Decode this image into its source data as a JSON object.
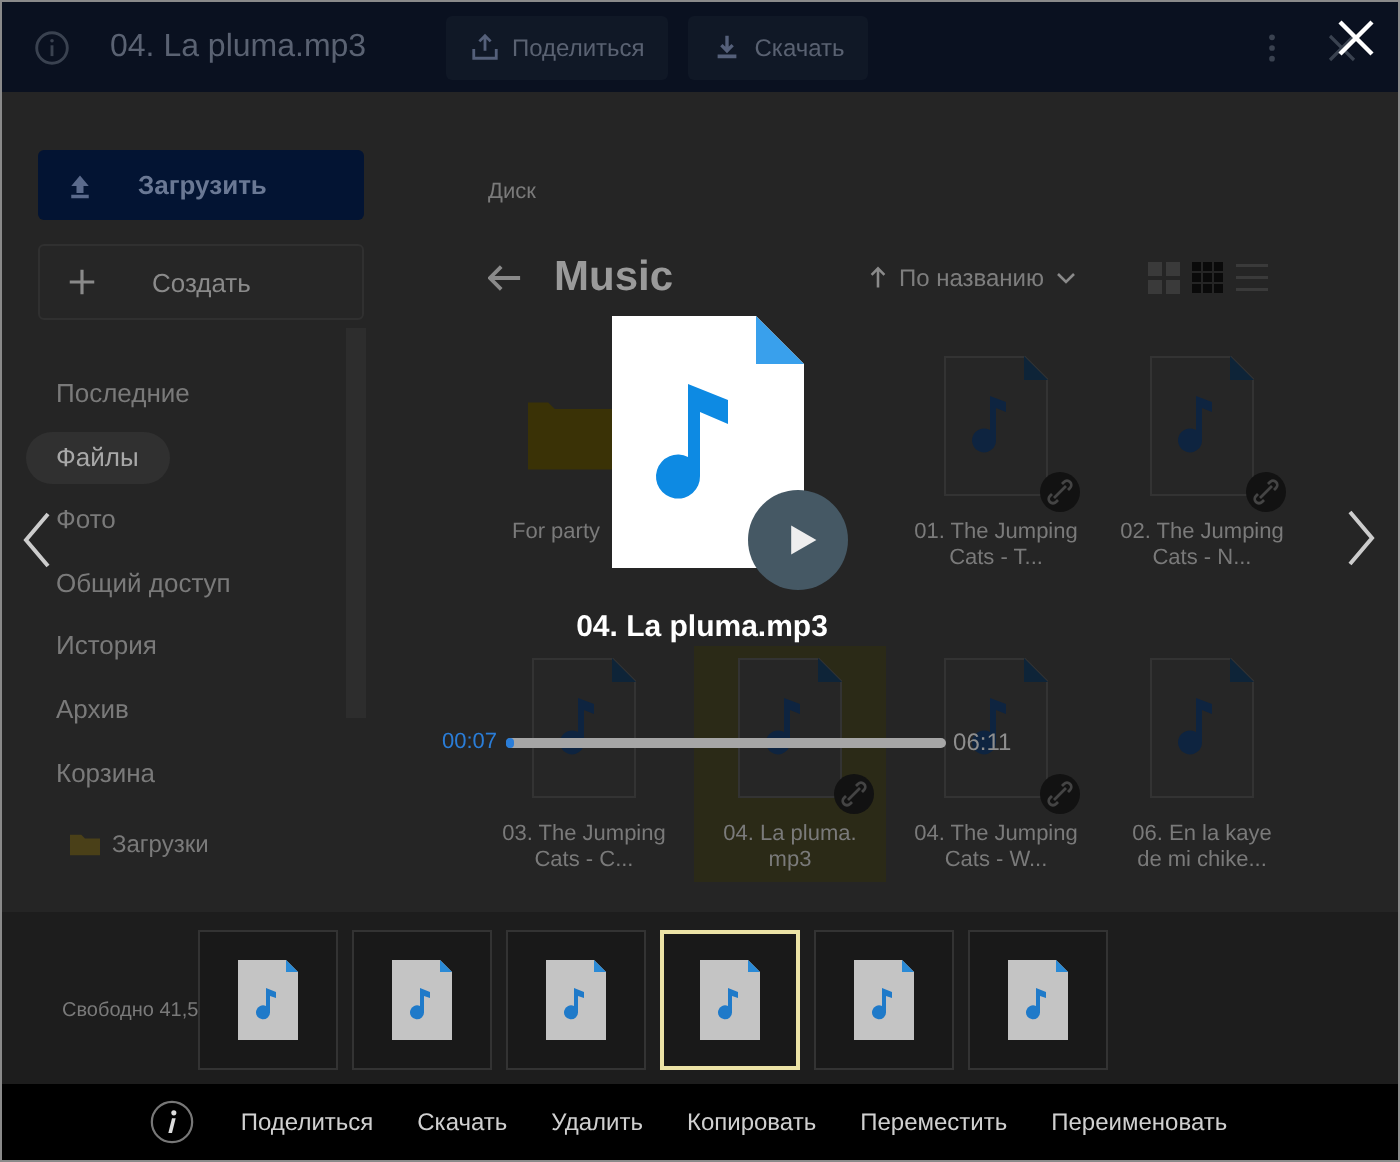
{
  "header": {
    "title": "04. La pluma.mp3",
    "buttons": [
      {
        "kind": "share",
        "label": "Поделиться"
      },
      {
        "kind": "download",
        "label": "Скачать"
      }
    ]
  },
  "sidebar": {
    "upload": "Загрузить",
    "create": "Создать",
    "nav": [
      {
        "label": "Последние",
        "selected": false
      },
      {
        "label": "Файлы",
        "selected": true
      },
      {
        "label": "Фото",
        "selected": false
      },
      {
        "label": "Общий доступ",
        "selected": false
      },
      {
        "label": "История",
        "selected": false
      },
      {
        "label": "Архив",
        "selected": false
      },
      {
        "label": "Корзина",
        "selected": false
      }
    ],
    "folders": [
      "Загрузки"
    ],
    "storage": "Свободно 41,5"
  },
  "main": {
    "breadcrumb": "Диск",
    "title": "Music",
    "sort": "По названию",
    "view_modes": [
      {
        "kind": "tiles",
        "selected": false
      },
      {
        "kind": "grid",
        "selected": true
      },
      {
        "kind": "list",
        "selected": false
      }
    ],
    "rows": [
      [
        {
          "kind": "folder",
          "name": "For party",
          "shared": false,
          "selected": false
        },
        "",
        {
          "kind": "audio",
          "name": "01. The Jumping Cats - T...",
          "shared": true,
          "selected": false
        },
        {
          "kind": "audio",
          "name": "02. The Jumping Cats - N...",
          "shared": true,
          "selected": false
        }
      ],
      [
        {
          "kind": "audio",
          "name": "03. The Jumping Cats - C...",
          "shared": false,
          "selected": false
        },
        {
          "kind": "audio",
          "name": "04. La pluma. mp3",
          "shared": true,
          "selected": true
        },
        {
          "kind": "audio",
          "name": "04. The Jumping Cats - W...",
          "shared": true,
          "selected": false
        },
        {
          "kind": "audio",
          "name": "06. En la kaye de mi chike...",
          "shared": false,
          "selected": false
        }
      ]
    ]
  },
  "player": {
    "title": "04. La pluma.mp3",
    "elapsed": "00:07",
    "duration": "06:11",
    "level": 0.02
  },
  "thumbnails": [
    {
      "selected": false
    },
    {
      "selected": false
    },
    {
      "selected": false
    },
    {
      "selected": true
    },
    {
      "selected": false
    },
    {
      "selected": false
    }
  ],
  "actions": [
    "Поделиться",
    "Скачать",
    "Удалить",
    "Копировать",
    "Переместить",
    "Переименовать"
  ]
}
